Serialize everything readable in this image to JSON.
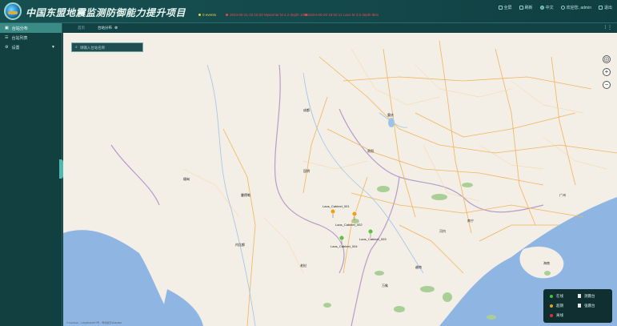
{
  "header": {
    "title": "中国东盟地震监测防御能力提升项目",
    "ticker": [
      {
        "text": "0 events",
        "color": "#f0d040"
      },
      {
        "text": "2024-05-21 02:15:33 Myanmar M 4.2 depth 10km",
        "color": "#e84a4a"
      },
      {
        "text": "2024-05-20 18:02:11 Laos M 3.6 depth 8km",
        "color": "#e84a4a"
      }
    ],
    "right_items": [
      {
        "icon": "screen-icon",
        "label": "全屏"
      },
      {
        "icon": "refresh-icon",
        "label": "刷新"
      },
      {
        "icon": "language-icon",
        "label": "中文"
      },
      {
        "icon": "user-icon",
        "label": "欢迎您, admin"
      },
      {
        "icon": "logout-icon",
        "label": "退出"
      }
    ]
  },
  "sidebar": {
    "items": [
      {
        "label": "台站分布",
        "icon": "map-icon",
        "active": true
      },
      {
        "label": "台站列表",
        "icon": "list-icon",
        "active": false
      },
      {
        "label": "设置",
        "icon": "settings-icon",
        "active": false,
        "expandable": true
      }
    ]
  },
  "tabs": {
    "items": [
      {
        "label": "首页",
        "active": false
      },
      {
        "label": "台站分布",
        "active": true
      }
    ]
  },
  "map": {
    "search_placeholder": "请输入台站名称",
    "stations": [
      {
        "name": "Laos_Cabinet_001",
        "color": "#f0a020"
      },
      {
        "name": "Laos_Cabinet_002",
        "color": "#f0a020"
      },
      {
        "name": "Laos_Cabinet_003",
        "color": "#66c040"
      },
      {
        "name": "Laos_Cabinet_004",
        "color": "#66c040"
      }
    ],
    "labels": [
      "成都",
      "重庆",
      "贵阳",
      "昆明",
      "南宁",
      "广州",
      "河内",
      "万象",
      "内比都",
      "曼德勒",
      "缅甸",
      "老挝",
      "越南",
      "海南"
    ],
    "copyright": "© AutoNavi – GS(2023)4677号 – 甲测资字11111093"
  },
  "legend": {
    "items": [
      {
        "label": "在线",
        "color": "#44c040",
        "kind": "dot"
      },
      {
        "label": "超期",
        "color": "#e8a020",
        "kind": "dot"
      },
      {
        "label": "离线",
        "color": "#e03030",
        "kind": "dot"
      },
      {
        "label": "测震台",
        "kind": "square"
      },
      {
        "label": "强震台",
        "kind": "square"
      }
    ]
  }
}
